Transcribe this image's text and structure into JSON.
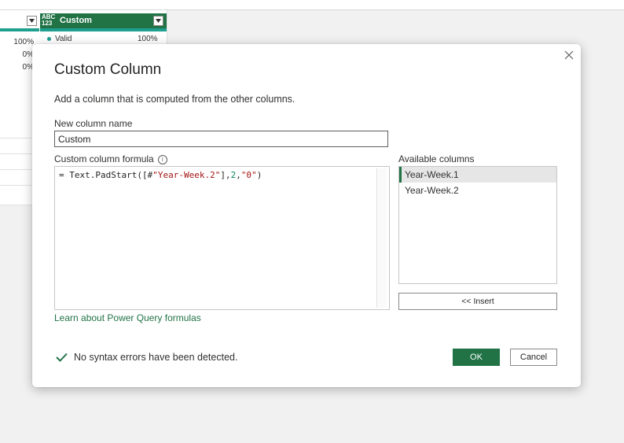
{
  "background": {
    "column_header": {
      "type_label_top": "ABC",
      "type_label_bottom": "123",
      "name": "Custom"
    },
    "left_column_pcts": [
      "100%",
      "0%",
      "0%"
    ],
    "custom_column_valid_label": "Valid",
    "custom_column_valid_pct": "100%"
  },
  "dialog": {
    "title": "Custom Column",
    "description": "Add a column that is computed from the other columns.",
    "new_column_name_label": "New column name",
    "new_column_name_value": "Custom",
    "formula_label": "Custom column formula",
    "formula": {
      "prefix": "= Text.PadStart([#",
      "col_string": "\"Year-Week.2\"",
      "mid": "],",
      "num": "2",
      "comma": ",",
      "pad_string": "\"0\"",
      "suffix": ")"
    },
    "available_columns_label": "Available columns",
    "available_columns": [
      "Year-Week.1",
      "Year-Week.2"
    ],
    "insert_label": "<< Insert",
    "learn_link": "Learn about Power Query formulas",
    "status_text": "No syntax errors have been detected.",
    "ok_label": "OK",
    "cancel_label": "Cancel"
  },
  "colors": {
    "accent": "#217346",
    "quality_bar": "#1f9f8f"
  },
  "icons": {
    "close": "close-icon",
    "info": "info-icon",
    "status": "checkmark-icon",
    "dropdown": "chevron-down-icon"
  }
}
